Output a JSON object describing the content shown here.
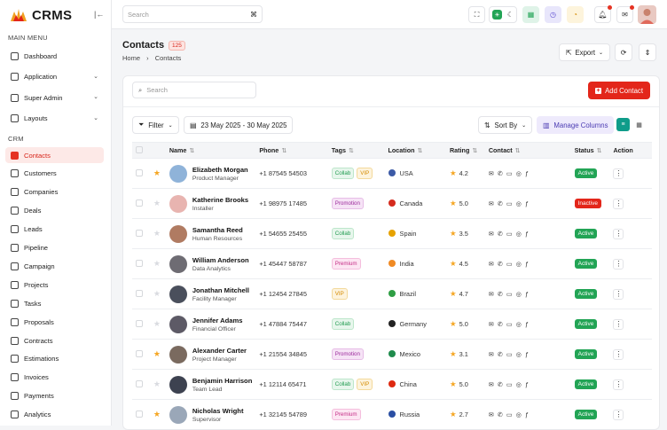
{
  "app": {
    "name": "CRMS"
  },
  "topbar": {
    "search_placeholder": "Search",
    "search_shortcut": "⌘"
  },
  "sidebar": {
    "main_menu_label": "MAIN MENU",
    "crm_label": "CRM",
    "main_items": [
      {
        "label": "Dashboard",
        "has_children": false
      },
      {
        "label": "Application",
        "has_children": true
      },
      {
        "label": "Super Admin",
        "has_children": true
      },
      {
        "label": "Layouts",
        "has_children": true
      }
    ],
    "crm_items": [
      {
        "label": "Contacts",
        "active": true
      },
      {
        "label": "Customers"
      },
      {
        "label": "Companies"
      },
      {
        "label": "Deals"
      },
      {
        "label": "Leads"
      },
      {
        "label": "Pipeline"
      },
      {
        "label": "Campaign"
      },
      {
        "label": "Projects"
      },
      {
        "label": "Tasks"
      },
      {
        "label": "Proposals"
      },
      {
        "label": "Contracts"
      },
      {
        "label": "Estimations"
      },
      {
        "label": "Invoices"
      },
      {
        "label": "Payments"
      },
      {
        "label": "Analytics"
      }
    ]
  },
  "page": {
    "title": "Contacts",
    "count": "125",
    "breadcrumb": [
      "Home",
      "Contacts"
    ],
    "export_label": "Export"
  },
  "toolbar": {
    "search_placeholder": "Search",
    "add_label": "Add Contact",
    "filter_label": "Filter",
    "date_range": "23 May 2025 - 30 May 2025",
    "sort_label": "Sort By",
    "manage_label": "Manage Columns"
  },
  "table": {
    "headers": [
      "Name",
      "Phone",
      "Tags",
      "Location",
      "Rating",
      "Contact",
      "Status",
      "Action"
    ],
    "rows": [
      {
        "name": "Elizabeth Morgan",
        "role": "Product Manager",
        "phone": "+1 87545 54503",
        "tags": [
          "Collab",
          "VIP"
        ],
        "location": "USA",
        "rating": "4.2",
        "status": "Active",
        "starred": true,
        "avatar_color": "#8fb3d9",
        "flag_color": "#3c5aa6"
      },
      {
        "name": "Katherine Brooks",
        "role": "Installer",
        "phone": "+1 98975 17485",
        "tags": [
          "Promotion"
        ],
        "location": "Canada",
        "rating": "5.0",
        "status": "Inactive",
        "starred": false,
        "avatar_color": "#e8b4b0",
        "flag_color": "#d52b1e"
      },
      {
        "name": "Samantha Reed",
        "role": "Human Resources",
        "phone": "+1 54655 25455",
        "tags": [
          "Collab"
        ],
        "location": "Spain",
        "rating": "3.5",
        "status": "Active",
        "starred": false,
        "avatar_color": "#b07b62",
        "flag_color": "#e6a200"
      },
      {
        "name": "William Anderson",
        "role": "Data Analytics",
        "phone": "+1 45447 58787",
        "tags": [
          "Premium"
        ],
        "location": "India",
        "rating": "4.5",
        "status": "Active",
        "starred": false,
        "avatar_color": "#6e6c73",
        "flag_color": "#f08a24"
      },
      {
        "name": "Jonathan Mitchell",
        "role": "Facility Manager",
        "phone": "+1 12454 27845",
        "tags": [
          "VIP"
        ],
        "location": "Brazil",
        "rating": "4.7",
        "status": "Active",
        "starred": false,
        "avatar_color": "#4a4f5c",
        "flag_color": "#2f9e44"
      },
      {
        "name": "Jennifer Adams",
        "role": "Financial Officer",
        "phone": "+1 47884 75447",
        "tags": [
          "Collab"
        ],
        "location": "Germany",
        "rating": "5.0",
        "status": "Active",
        "starred": false,
        "avatar_color": "#5d5a66",
        "flag_color": "#222222"
      },
      {
        "name": "Alexander Carter",
        "role": "Project Manager",
        "phone": "+1 21554 34845",
        "tags": [
          "Promotion"
        ],
        "location": "Mexico",
        "rating": "3.1",
        "status": "Active",
        "starred": true,
        "avatar_color": "#7a6a5f",
        "flag_color": "#1f8b4c"
      },
      {
        "name": "Benjamin Harrison",
        "role": "Team Lead",
        "phone": "+1 12114 65471",
        "tags": [
          "Collab",
          "VIP"
        ],
        "location": "China",
        "rating": "5.0",
        "status": "Active",
        "starred": false,
        "avatar_color": "#3d4250",
        "flag_color": "#de2910"
      },
      {
        "name": "Nicholas Wright",
        "role": "Supervisor",
        "phone": "+1 32145 54789",
        "tags": [
          "Premium"
        ],
        "location": "Russia",
        "rating": "2.7",
        "status": "Active",
        "starred": true,
        "avatar_color": "#9aa7b8",
        "flag_color": "#2b4fa3"
      }
    ]
  },
  "colors": {
    "accent": "#e3261a",
    "active": "#22a455",
    "star": "#f5a623"
  }
}
